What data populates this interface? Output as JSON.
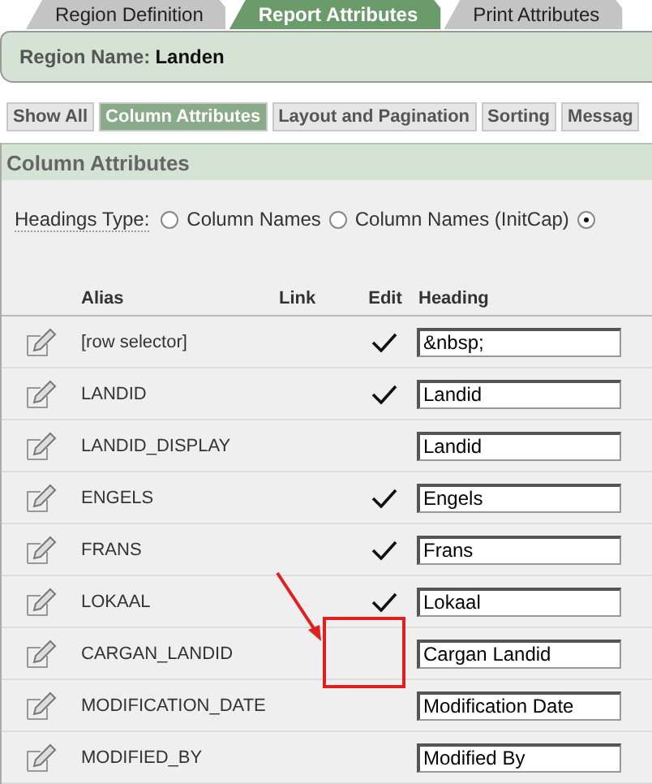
{
  "tabs": [
    {
      "label": "Region Definition",
      "selected": false
    },
    {
      "label": "Report Attributes",
      "selected": true
    },
    {
      "label": "Print Attributes",
      "selected": false
    }
  ],
  "region": {
    "label": "Region Name:",
    "value": "Landen"
  },
  "buttons": [
    {
      "label": "Show All",
      "selected": false
    },
    {
      "label": "Column Attributes",
      "selected": true
    },
    {
      "label": "Layout and Pagination",
      "selected": false
    },
    {
      "label": "Sorting",
      "selected": false
    },
    {
      "label": "Messag",
      "selected": false
    }
  ],
  "section": {
    "title": "Column Attributes",
    "headings_type": {
      "label": "Headings Type:",
      "options": [
        {
          "label": "Column Names",
          "selected": false
        },
        {
          "label": "Column Names (InitCap)",
          "selected": false
        },
        {
          "selected": true
        }
      ]
    },
    "table": {
      "columns": [
        "Alias",
        "Link",
        "Edit",
        "Heading"
      ],
      "rows": [
        {
          "alias": "[row selector]",
          "edit": true,
          "heading": "&nbsp;"
        },
        {
          "alias": "LANDID",
          "edit": true,
          "heading": "Landid"
        },
        {
          "alias": "LANDID_DISPLAY",
          "edit": false,
          "heading": "Landid"
        },
        {
          "alias": "ENGELS",
          "edit": true,
          "heading": "Engels"
        },
        {
          "alias": "FRANS",
          "edit": true,
          "heading": "Frans"
        },
        {
          "alias": "LOKAAL",
          "edit": true,
          "heading": "Lokaal"
        },
        {
          "alias": "CARGAN_LANDID",
          "edit": false,
          "heading": "Cargan Landid"
        },
        {
          "alias": "MODIFICATION_DATE",
          "edit": false,
          "heading": "Modification Date"
        },
        {
          "alias": "MODIFIED_BY",
          "edit": false,
          "heading": "Modified By"
        }
      ]
    }
  }
}
